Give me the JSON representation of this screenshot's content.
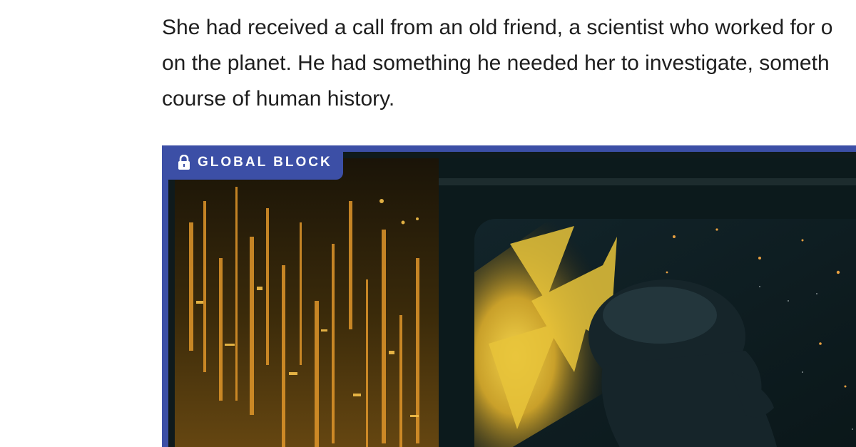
{
  "story": {
    "line1": "She had received a call from an old friend, a scientist who worked for o",
    "line2": "on the planet. He had something he needed her to investigate, someth",
    "line3": "course of human history."
  },
  "block": {
    "badge_label": "GLOBAL BLOCK",
    "badge_icon": "lock-icon",
    "accent_color": "#3c4fa6"
  },
  "artwork": {
    "alt": "Woman silhouette looking out a window at a glowing golden city"
  }
}
